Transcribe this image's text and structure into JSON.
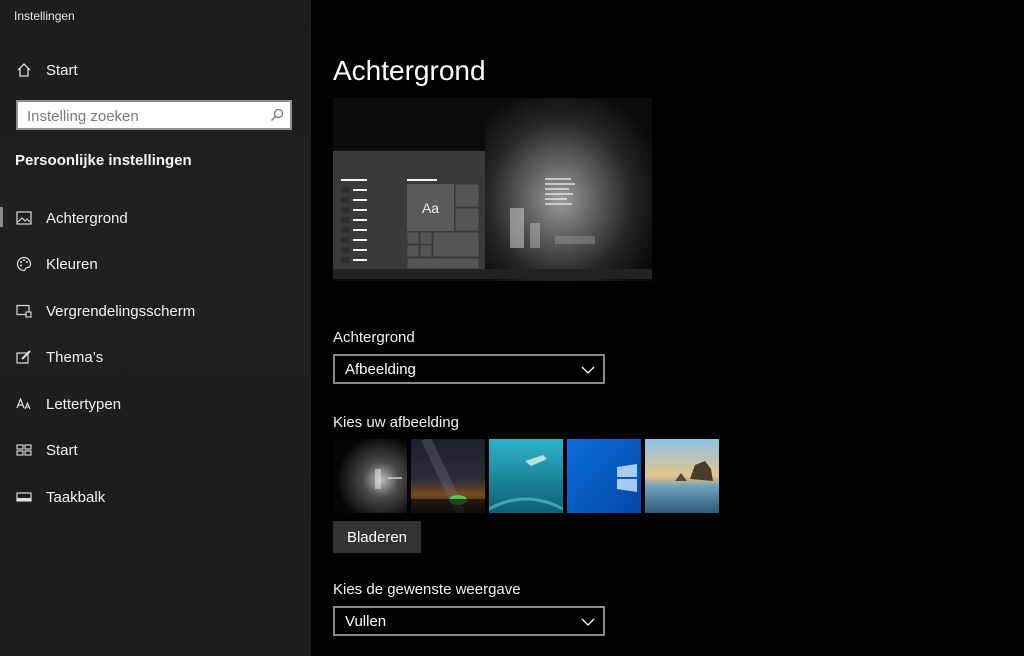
{
  "window": {
    "title": "Instellingen"
  },
  "sidebar": {
    "home_label": "Start",
    "search_placeholder": "Instelling zoeken",
    "section_title": "Persoonlijke instellingen",
    "items": [
      {
        "label": "Achtergrond",
        "icon": "picture-icon",
        "active": true
      },
      {
        "label": "Kleuren",
        "icon": "palette-icon",
        "active": false
      },
      {
        "label": "Vergrendelingsscherm",
        "icon": "lock-screen-icon",
        "active": false
      },
      {
        "label": "Thema’s",
        "icon": "theme-brush-icon",
        "active": false
      },
      {
        "label": "Lettertypen",
        "icon": "font-icon",
        "active": false
      },
      {
        "label": "Start",
        "icon": "start-tiles-icon",
        "active": false
      },
      {
        "label": "Taakbalk",
        "icon": "taskbar-icon",
        "active": false
      }
    ]
  },
  "main": {
    "title": "Achtergrond",
    "preview": {
      "tile_label": "Aa"
    },
    "background_label": "Achtergrond",
    "background_value": "Afbeelding",
    "choose_picture_label": "Kies uw afbeelding",
    "thumbnails": [
      "calvin-and-hobbes-wallpaper",
      "night-sky-tent",
      "underwater-swimmer",
      "windows-blue",
      "beach-rocks"
    ],
    "browse_label": "Bladeren",
    "fit_label": "Kies de gewenste weergave",
    "fit_value": "Vullen"
  },
  "colors": {
    "sidebar_bg": "#1f1f1f",
    "main_bg": "#000000",
    "button_bg": "#333333",
    "dropdown_border": "#8a8a8a"
  }
}
